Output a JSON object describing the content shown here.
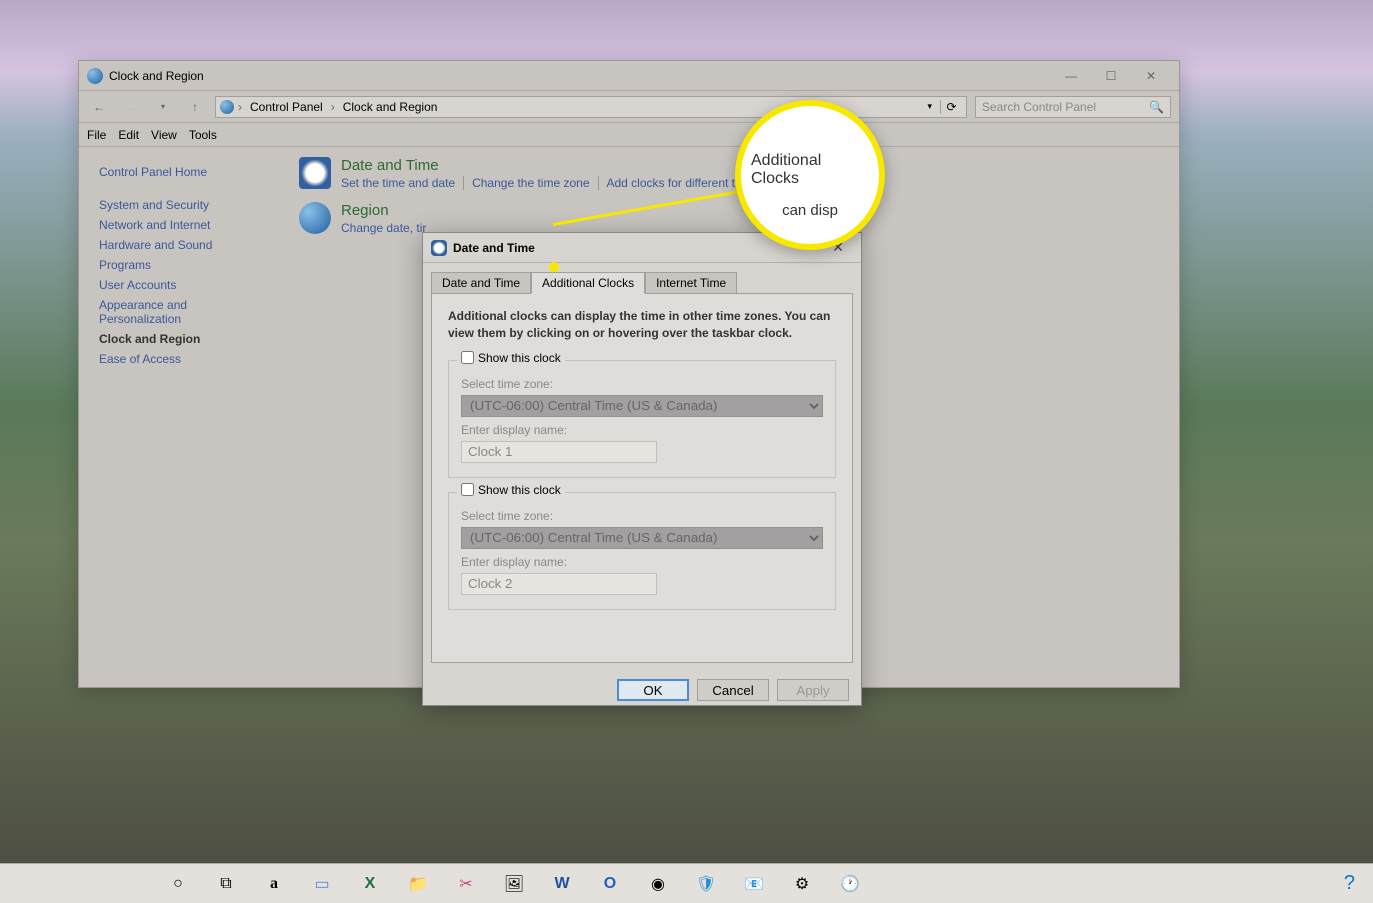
{
  "window": {
    "title": "Clock and Region",
    "breadcrumb": [
      "Control Panel",
      "Clock and Region"
    ],
    "search_placeholder": "Search Control Panel"
  },
  "menu": [
    "File",
    "Edit",
    "View",
    "Tools"
  ],
  "sidebar": {
    "home": "Control Panel Home",
    "items": [
      {
        "label": "System and Security"
      },
      {
        "label": "Network and Internet"
      },
      {
        "label": "Hardware and Sound"
      },
      {
        "label": "Programs"
      },
      {
        "label": "User Accounts"
      },
      {
        "label": "Appearance and Personalization"
      },
      {
        "label": "Clock and Region",
        "active": true
      },
      {
        "label": "Ease of Access"
      }
    ]
  },
  "main": {
    "sections": [
      {
        "heading": "Date and Time",
        "links": [
          "Set the time and date",
          "Change the time zone",
          "Add clocks for different t"
        ]
      },
      {
        "heading": "Region",
        "links": [
          "Change date, tir"
        ]
      }
    ]
  },
  "dialog": {
    "title": "Date and Time",
    "tabs": [
      "Date and Time",
      "Additional Clocks",
      "Internet Time"
    ],
    "active_tab": 1,
    "description": "Additional clocks can display the time in other time zones. You can view them by clicking on or hovering over the taskbar clock.",
    "clocks": [
      {
        "checkbox_label": "Show this clock",
        "tz_label": "Select time zone:",
        "tz_value": "(UTC-06:00) Central Time (US & Canada)",
        "name_label": "Enter display name:",
        "name_value": "Clock 1"
      },
      {
        "checkbox_label": "Show this clock",
        "tz_label": "Select time zone:",
        "tz_value": "(UTC-06:00) Central Time (US & Canada)",
        "name_label": "Enter display name:",
        "name_value": "Clock 2"
      }
    ],
    "buttons": {
      "ok": "OK",
      "cancel": "Cancel",
      "apply": "Apply"
    }
  },
  "callout": {
    "primary": "Additional Clocks",
    "secondary": "can disp"
  },
  "taskbar": {
    "items": [
      "cortana",
      "task-view",
      "amazon",
      "screen",
      "excel",
      "explorer",
      "snip",
      "photos",
      "word",
      "outlook",
      "chrome",
      "defender",
      "mail",
      "settings",
      "datetime"
    ]
  }
}
